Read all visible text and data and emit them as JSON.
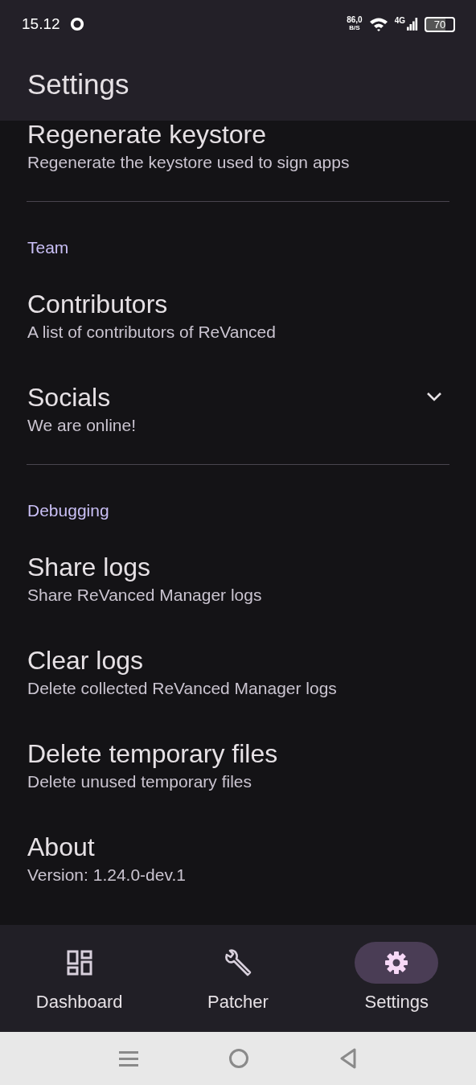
{
  "status_bar": {
    "time": "15.12",
    "net_speed": "86,0",
    "net_unit": "B/S",
    "network_type": "4G",
    "battery": "70"
  },
  "app_bar": {
    "title": "Settings"
  },
  "sections": [
    {
      "items": [
        {
          "title": "Regenerate keystore",
          "subtitle": "Regenerate the keystore used to sign apps"
        }
      ]
    },
    {
      "header": "Team",
      "items": [
        {
          "title": "Contributors",
          "subtitle": "A list of contributors of ReVanced"
        },
        {
          "title": "Socials",
          "subtitle": "We are online!",
          "expanded": false
        }
      ]
    },
    {
      "header": "Debugging",
      "items": [
        {
          "title": "Share logs",
          "subtitle": "Share ReVanced Manager logs"
        },
        {
          "title": "Clear logs",
          "subtitle": "Delete collected ReVanced Manager logs"
        },
        {
          "title": "Delete temporary files",
          "subtitle": "Delete unused temporary files"
        },
        {
          "title": "About",
          "subtitle": "Version: 1.24.0-dev.1"
        }
      ]
    }
  ],
  "nav": [
    {
      "label": "Dashboard",
      "selected": false
    },
    {
      "label": "Patcher",
      "selected": false
    },
    {
      "label": "Settings",
      "selected": true
    }
  ]
}
